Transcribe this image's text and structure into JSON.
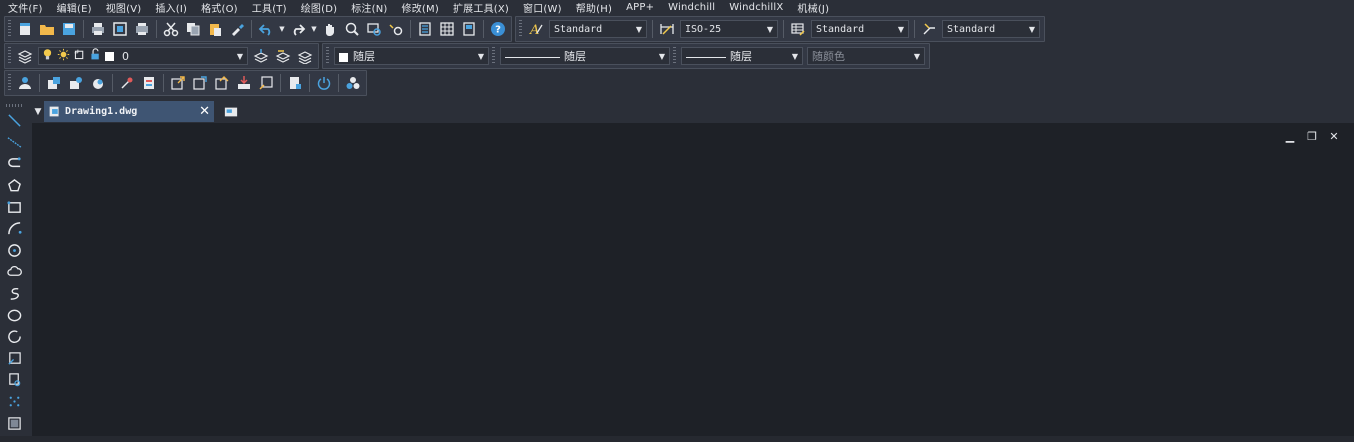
{
  "menu": [
    "文件(F)",
    "编辑(E)",
    "视图(V)",
    "插入(I)",
    "格式(O)",
    "工具(T)",
    "绘图(D)",
    "标注(N)",
    "修改(M)",
    "扩展工具(X)",
    "窗口(W)",
    "帮助(H)",
    "APP+",
    "Windchill",
    "WindchillX",
    "机械(J)"
  ],
  "toolbar1": {
    "text_style": "Standard",
    "dim_style": "ISO-25",
    "table_style": "Standard",
    "mleader_style": "Standard"
  },
  "toolbar2": {
    "layer": "0",
    "color": "随层",
    "linetype": "随层",
    "lineweight": "随层",
    "plot_style": "随颜色"
  },
  "tabs": {
    "active": "Drawing1.dwg"
  },
  "colors": {
    "accent": "#3f5573",
    "icon_blue": "#4aa3df",
    "icon_yellow": "#f2c94c",
    "background": "#2b2f38",
    "canvas": "#1e2127"
  }
}
